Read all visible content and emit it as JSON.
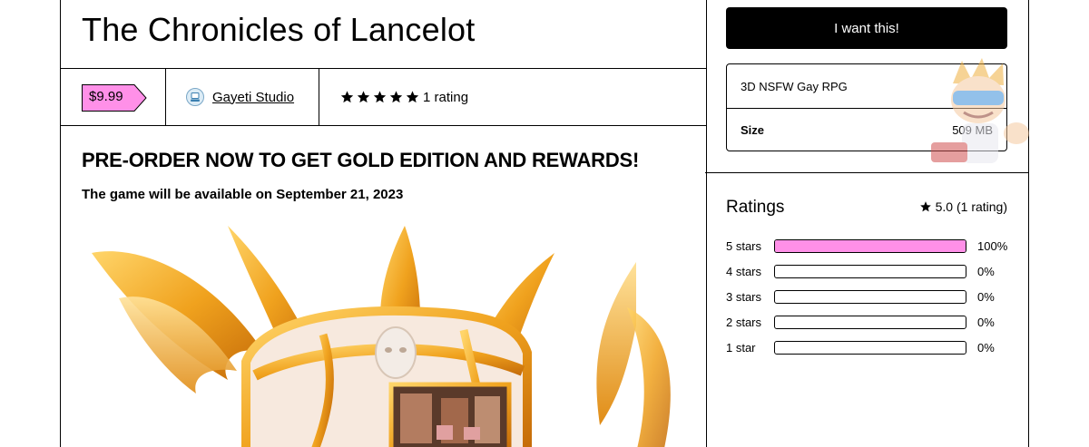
{
  "product": {
    "title": "The Chronicles of Lancelot",
    "price": "$9.99",
    "creator": "Gayeti Studio",
    "rating_count_text": "1 rating",
    "headline": "PRE-ORDER NOW TO GET GOLD EDITION AND REWARDS!",
    "subline": "The game will be available on September 21, 2023"
  },
  "sidebar": {
    "cta_label": "I want this!",
    "summary": "3D NSFW Gay RPG",
    "size_label": "Size",
    "size_value": "509 MB",
    "ratings_heading": "Ratings",
    "ratings_summary": "5.0 (1 rating)",
    "breakdown": [
      {
        "label": "5 stars",
        "percent_text": "100%",
        "fraction": 1.0
      },
      {
        "label": "4 stars",
        "percent_text": "0%",
        "fraction": 0
      },
      {
        "label": "3 stars",
        "percent_text": "0%",
        "fraction": 0
      },
      {
        "label": "2 stars",
        "percent_text": "0%",
        "fraction": 0
      },
      {
        "label": "1 star",
        "percent_text": "0%",
        "fraction": 0
      }
    ]
  },
  "icons": {
    "star": "star-icon",
    "avatar": "creator-avatar-icon"
  },
  "colors": {
    "accent_pink": "#ff90e8",
    "cta_bg": "#000000",
    "gold": "#f0a21e"
  }
}
